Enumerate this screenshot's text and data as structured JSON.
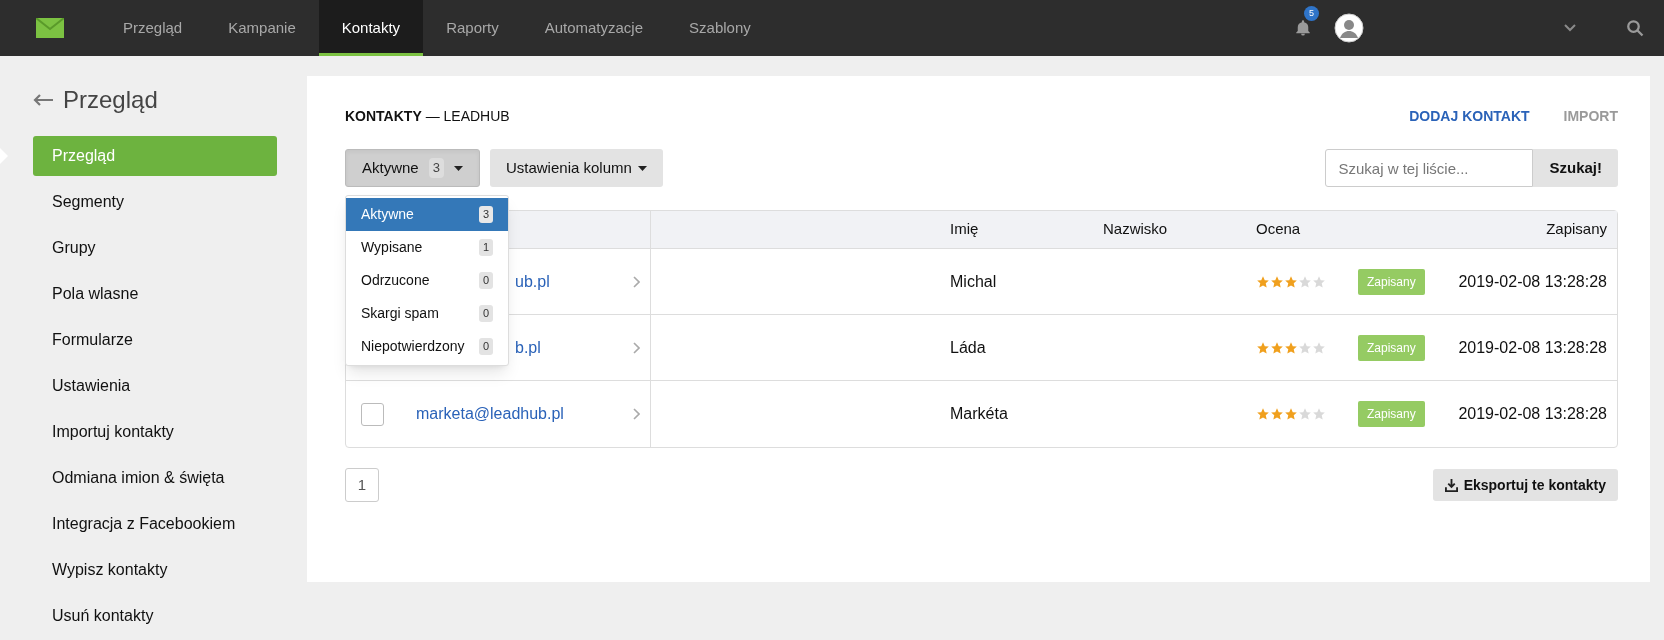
{
  "nav": {
    "items": [
      {
        "label": "Przegląd",
        "selected": false
      },
      {
        "label": "Kampanie",
        "selected": false
      },
      {
        "label": "Kontakty",
        "selected": true
      },
      {
        "label": "Raporty",
        "selected": false
      },
      {
        "label": "Automatyzacje",
        "selected": false
      },
      {
        "label": "Szablony",
        "selected": false
      }
    ],
    "notifications": "5"
  },
  "sidebar": {
    "back_label": "Przegląd",
    "items": [
      {
        "label": "Przegląd",
        "selected": true
      },
      {
        "label": "Segmenty",
        "selected": false
      },
      {
        "label": "Grupy",
        "selected": false
      },
      {
        "label": "Pola wlasne",
        "selected": false
      },
      {
        "label": "Formularze",
        "selected": false
      },
      {
        "label": "Ustawienia",
        "selected": false
      },
      {
        "label": "Importuj kontakty",
        "selected": false
      },
      {
        "label": "Odmiana imion & święta",
        "selected": false
      },
      {
        "label": "Integracja z Facebookiem",
        "selected": false
      },
      {
        "label": "Wypisz kontakty",
        "selected": false
      },
      {
        "label": "Usuń kontakty",
        "selected": false
      }
    ]
  },
  "page": {
    "title": "KONTAKTY",
    "subtitle": "— LEADHUB",
    "actions": [
      {
        "label": "DODAJ KONTAKT",
        "kind": "primary"
      },
      {
        "label": "IMPORT",
        "kind": "muted"
      }
    ]
  },
  "filter": {
    "label": "Aktywne",
    "count": "3",
    "expanded": true,
    "options": [
      {
        "label": "Aktywne",
        "count": "3",
        "selected": true
      },
      {
        "label": "Wypisane",
        "count": "1",
        "selected": false
      },
      {
        "label": "Odrzucone",
        "count": "0",
        "selected": false
      },
      {
        "label": "Skargi spam",
        "count": "0",
        "selected": false
      },
      {
        "label": "Niepotwierdzony",
        "count": "0",
        "selected": false
      }
    ]
  },
  "columns_button": "Ustawienia kolumn",
  "search": {
    "placeholder": "Szukaj w tej liście...",
    "button": "Szukaj!"
  },
  "table": {
    "columns": [
      "Imię",
      "Nazwisko",
      "Ocena",
      "Zapisany"
    ],
    "rows": [
      {
        "email": "ub.pl",
        "first_name": "Michal",
        "stars": 3,
        "status": "Zapisany",
        "date": "2019-02-08 13:28:28"
      },
      {
        "email": "b.pl",
        "first_name": "Láda",
        "stars": 3,
        "status": "Zapisany",
        "date": "2019-02-08 13:28:28"
      },
      {
        "email": "marketa@leadhub.pl",
        "checked": false,
        "first_name": "Markéta",
        "stars": 3,
        "status": "Zapisany",
        "date": "2019-02-08 13:28:28"
      }
    ]
  },
  "pagination": [
    {
      "label": "1",
      "selected": true
    }
  ],
  "export_button": "Eksportuj te kontakty"
}
